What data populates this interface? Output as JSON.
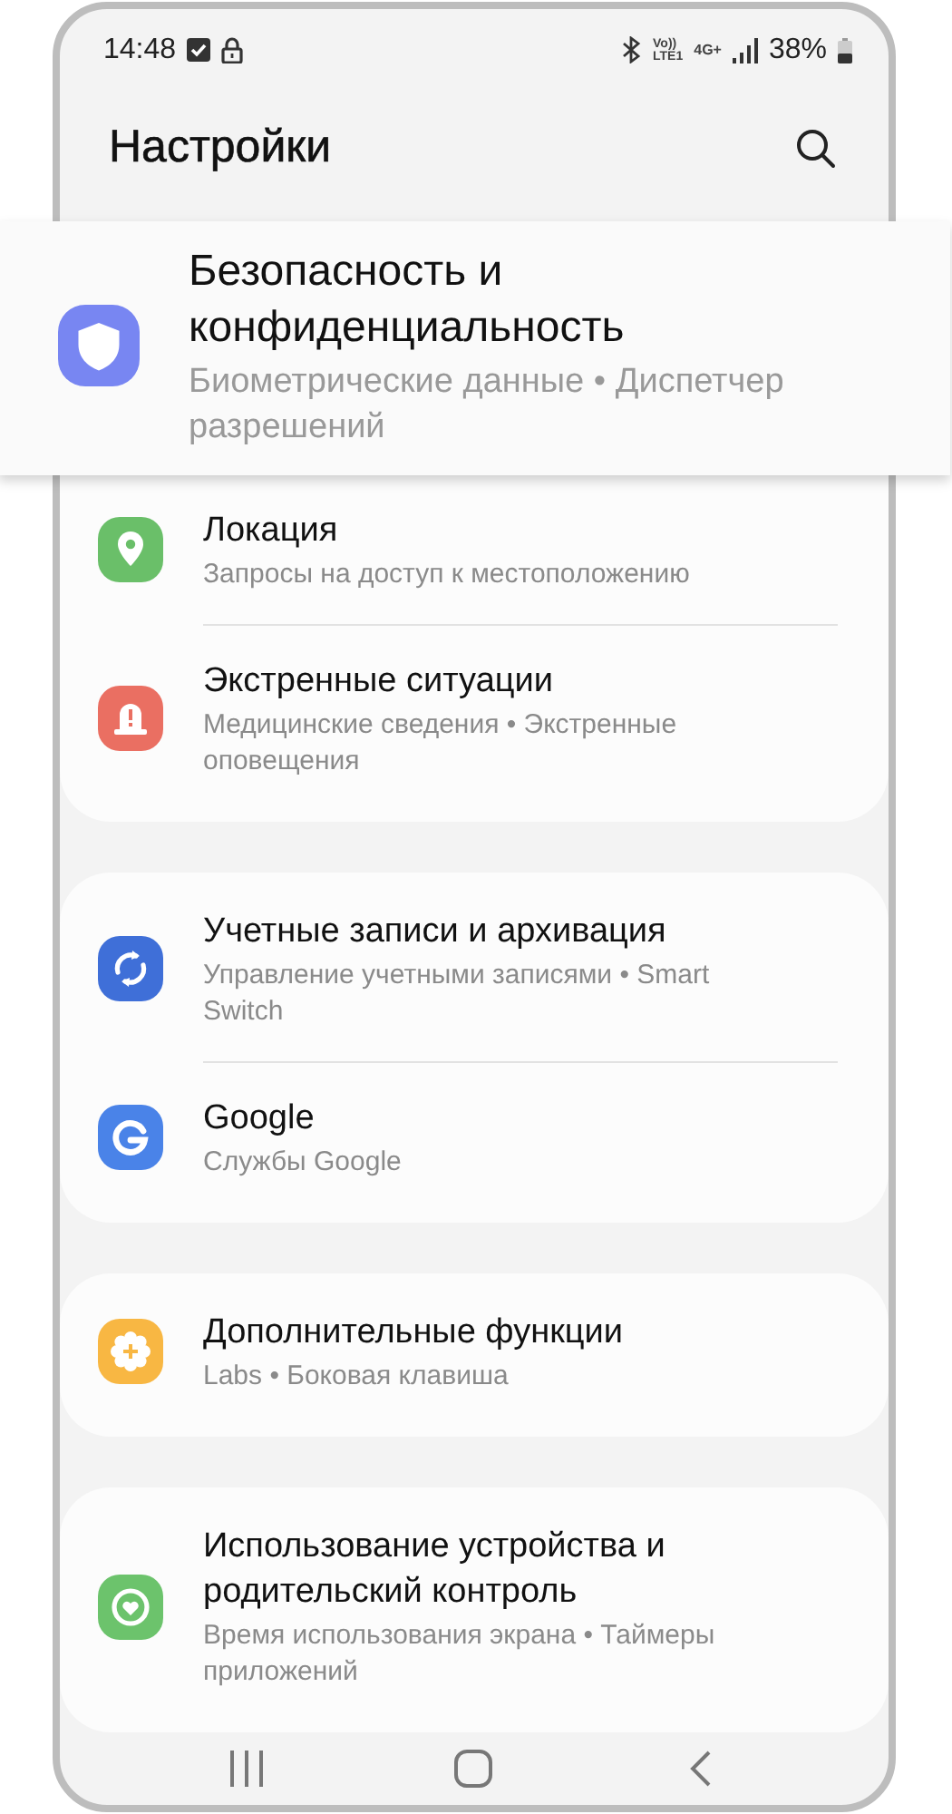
{
  "status_bar": {
    "time": "14:48",
    "network_labels": [
      "Vo))",
      "LTE1",
      "4G+"
    ],
    "battery": "38%"
  },
  "header": {
    "title": "Настройки"
  },
  "groups": [
    {
      "items": [
        {
          "title": "Безопасность и конфиденциальность",
          "subtitle": "Биометрические данные  •  Диспетчер разрешений",
          "kind": "shield",
          "color": "#7886f2",
          "highlighted": true
        },
        {
          "title": "Локация",
          "subtitle": "Запросы на доступ к местоположению",
          "kind": "pin",
          "color": "#6abf69",
          "highlighted": false
        },
        {
          "title": "Экстренные ситуации",
          "subtitle": "Медицинские сведения  •  Экстренные оповещения",
          "kind": "siren",
          "color": "#ea6f62",
          "highlighted": false
        }
      ]
    },
    {
      "items": [
        {
          "title": "Учетные записи и архивация",
          "subtitle": "Управление учетными записями  •  Smart Switch",
          "kind": "sync",
          "color": "#3f6fd8",
          "highlighted": false
        },
        {
          "title": "Google",
          "subtitle": "Службы Google",
          "kind": "g",
          "color": "#4a83e8",
          "highlighted": false
        }
      ]
    },
    {
      "items": [
        {
          "title": "Дополнительные функции",
          "subtitle": "Labs  •  Боковая клавиша",
          "kind": "gear",
          "color": "#f8b743",
          "highlighted": false
        }
      ]
    },
    {
      "items": [
        {
          "title": "Использование устройства и родительский контроль",
          "subtitle": "Время использования экрана  •  Таймеры приложений",
          "kind": "heart",
          "color": "#6cc36c",
          "highlighted": false
        }
      ]
    }
  ]
}
